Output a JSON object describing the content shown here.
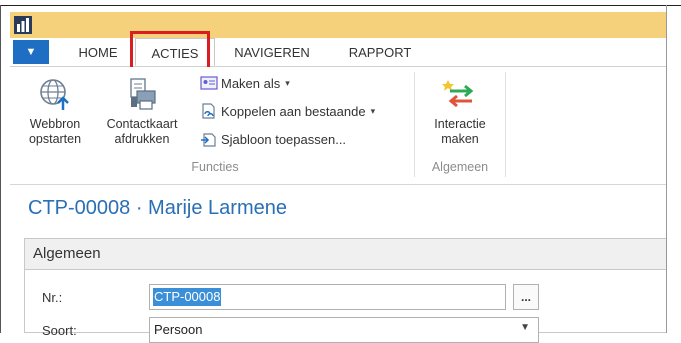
{
  "tabs": {
    "menu": "▼",
    "home": "HOME",
    "acties": "ACTIES",
    "navigeren": "NAVIGEREN",
    "rapport": "RAPPORT"
  },
  "ribbon": {
    "webbron_line1": "Webbron",
    "webbron_line2": "opstarten",
    "contactkaart_line1": "Contactkaart",
    "contactkaart_line2": "afdrukken",
    "maken_als": "Maken als",
    "koppelen": "Koppelen aan bestaande",
    "sjabloon": "Sjabloon toepassen...",
    "functies_label": "Functies",
    "interactie_line1": "Interactie",
    "interactie_line2": "maken",
    "algemeen_label": "Algemeen"
  },
  "page": {
    "title": "CTP-00008 · Marije Larmene"
  },
  "fasttab": {
    "title": "Algemeen",
    "nr_label": "Nr.:",
    "nr_value": "CTP-00008",
    "ellipsis": "...",
    "soort_label": "Soort:",
    "soort_value": "Persoon"
  },
  "colors": {
    "title_bar": "#f5d17b",
    "accent_blue": "#1e6fc4",
    "page_title": "#2a6fb6",
    "highlight": "#d81e1e"
  }
}
